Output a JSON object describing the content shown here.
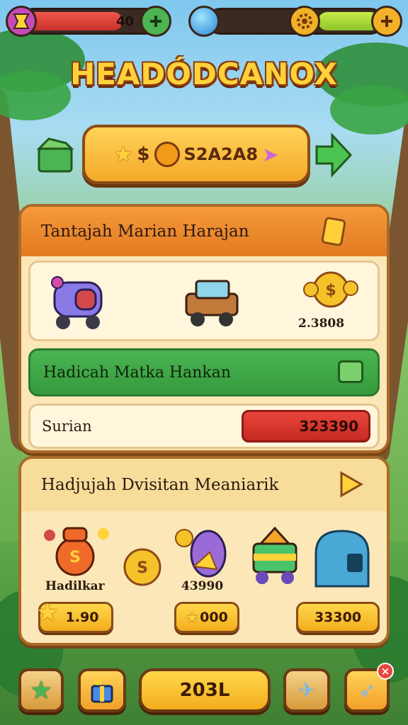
{
  "hud": {
    "health_value": "40",
    "health_fill_fraction": 0.72,
    "energy_fill_fraction": 0.38,
    "left_badge_icon": "shield-emblem-icon",
    "health_plus_icon": "green-plus-icon",
    "gem_icon": "blue-gem-icon",
    "gear_icon": "gear-icon",
    "add_icon": "gold-plus-icon"
  },
  "title": "HEADÓDCANOX",
  "banner": {
    "label": "S2A2A8",
    "currency_symbol": "$",
    "left_arrow_icon": "green-box-icon",
    "right_arrow_icon": "green-arrow-right-icon"
  },
  "panel1": {
    "header": "Tantajah Marian Harajan",
    "header_icon": "gold-tag-icon",
    "items": [
      {
        "icon": "purple-machine-icon"
      },
      {
        "icon": "brown-truck-icon"
      },
      {
        "icon": "coin-pile-icon",
        "value": "2.3808"
      }
    ],
    "green_row": {
      "label": "Hadicah Matka Hankan",
      "icon": "green-leaf-icon"
    },
    "score_row": {
      "label": "Surian",
      "value": "323390"
    }
  },
  "panel2": {
    "header": "Hadjujah Dvisitan Meaniarik",
    "header_icon": "yellow-play-icon",
    "items": [
      {
        "caption": "Hadilkar",
        "price": "1.90",
        "icon": "robot-coin-icon"
      },
      {
        "caption": "43990",
        "price": "000",
        "icon": "egg-coin-icon"
      },
      {
        "caption": "",
        "price": "33300",
        "icon": "cart-box-icon"
      }
    ]
  },
  "bottom_bar": {
    "center_label": "203L",
    "star_icon": "green-star-icon",
    "gift_icon": "gift-box-icon",
    "plane_icon": "paper-plane-icon",
    "rocket_icon": "rocket-icon"
  },
  "colors": {
    "accent_gold": "#ffd23a",
    "panel_orange": "#e27a22",
    "row_green": "#349a3c",
    "score_red": "#c52a22"
  }
}
